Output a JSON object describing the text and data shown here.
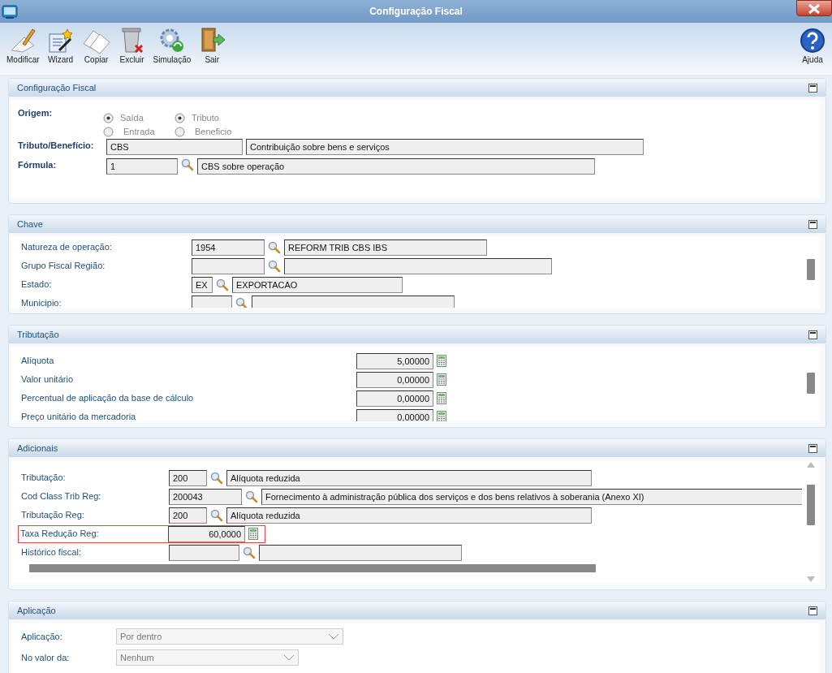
{
  "window": {
    "title": "Configuração Fiscal"
  },
  "toolbar": [
    {
      "label": "Modificar",
      "kind": "edit"
    },
    {
      "label": "Wizard",
      "kind": "wizard"
    },
    {
      "label": "Copiar",
      "kind": "copy"
    },
    {
      "label": "Excluir",
      "kind": "delete"
    },
    {
      "label": "Simulação",
      "kind": "simulate"
    },
    {
      "label": "Sair",
      "kind": "exit"
    }
  ],
  "help": {
    "label": "Ajuda"
  },
  "config": {
    "title": "Configuração Fiscal",
    "origem_label": "Origem:",
    "groups": [
      [
        {
          "label": "Saída",
          "selected": true
        },
        {
          "label": "Entrada",
          "selected": false
        }
      ],
      [
        {
          "label": "Tributo",
          "selected": true
        },
        {
          "label": "Beneficio",
          "selected": false
        }
      ]
    ],
    "rows": [
      {
        "label": "Tributo/Benefício:",
        "code": "CBS",
        "description": "Contribuição sobre bens e serviços",
        "lookup": false
      },
      {
        "label": "Fórmula:",
        "code": "1",
        "description": "CBS sobre operação",
        "lookup": true
      }
    ]
  },
  "chave": {
    "title": "Chave",
    "rows": [
      {
        "label": "Natureza de operação:",
        "code": "1954",
        "description": "REFORM TRIB CBS IBS"
      },
      {
        "label": "Grupo Fiscal Região:"
      },
      {
        "label": "Estado:",
        "code": "EX",
        "description": "EXPORTACAO"
      },
      {
        "label": "Municipio:"
      }
    ]
  },
  "tributacao": {
    "title": "Tributação",
    "rows": [
      {
        "label": "Alíquota",
        "value": "5,00000"
      },
      {
        "label": "Valor unitário",
        "value": "0,00000"
      },
      {
        "label": "Percentual de aplicação da base de cálculo",
        "value": "0,00000"
      },
      {
        "label": "Preço unitário da mercadoria",
        "value": "0,00000"
      }
    ]
  },
  "adicionais": {
    "title": "Adicionais",
    "rows": [
      {
        "kind": "lookup",
        "label": "Tributação:",
        "code": "200",
        "description": "Alíquota reduzida"
      },
      {
        "kind": "lookup",
        "label": "Cod Class Trib Reg:",
        "code": "200043",
        "description": "Fornecimento à administração pública dos serviços e dos bens relativos à soberania (Anexo XI)"
      },
      {
        "kind": "lookup",
        "label": "Tributação Reg:",
        "code": "200",
        "description": "Alíquota reduzida"
      },
      {
        "kind": "number",
        "label": "Taxa Redução Reg:",
        "value": "60,0000",
        "highlighted": true
      },
      {
        "kind": "lookup",
        "label": "Histórico fiscal:"
      }
    ]
  },
  "aplicacao": {
    "title": "Aplicação",
    "rows": [
      {
        "label": "Aplicação:",
        "value": "Por dentro"
      },
      {
        "label": "No valor da:",
        "value": "Nenhum"
      }
    ]
  }
}
